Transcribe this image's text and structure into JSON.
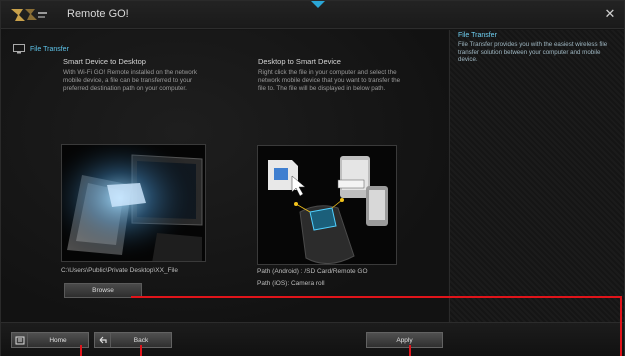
{
  "window": {
    "title": "Remote GO!",
    "close_icon": "close-icon"
  },
  "breadcrumb": {
    "label": "File Transfer",
    "icon": "monitor-icon"
  },
  "columns": [
    {
      "heading": "Smart Device to Desktop",
      "description": "With Wi-Fi GO! Remote installed on the network mobile device, a file can be transferred to your preferred destination path on your computer."
    },
    {
      "heading": "Desktop to Smart Device",
      "description": "Right click the file in your computer and select the network mobile device that you want to transfer the file to. The file will be displayed in below path."
    }
  ],
  "paths": {
    "desktop_path": "C:\\Users\\Public\\Private Desktop\\XX_File",
    "android_path": "Path (Android) : /SD Card/Remote GO",
    "ios_path": "Path (iOS): Camera roll"
  },
  "buttons": {
    "browse": "Browse",
    "home": "Home",
    "back": "Back",
    "apply": "Apply"
  },
  "info": {
    "title": "File Transfer",
    "text": "File Transfer provides you with the easiest wireless file transfer solution between your computer and mobile device."
  },
  "colors": {
    "accent": "#5ec4ea",
    "callout": "#e0141a",
    "background": "#141414"
  }
}
